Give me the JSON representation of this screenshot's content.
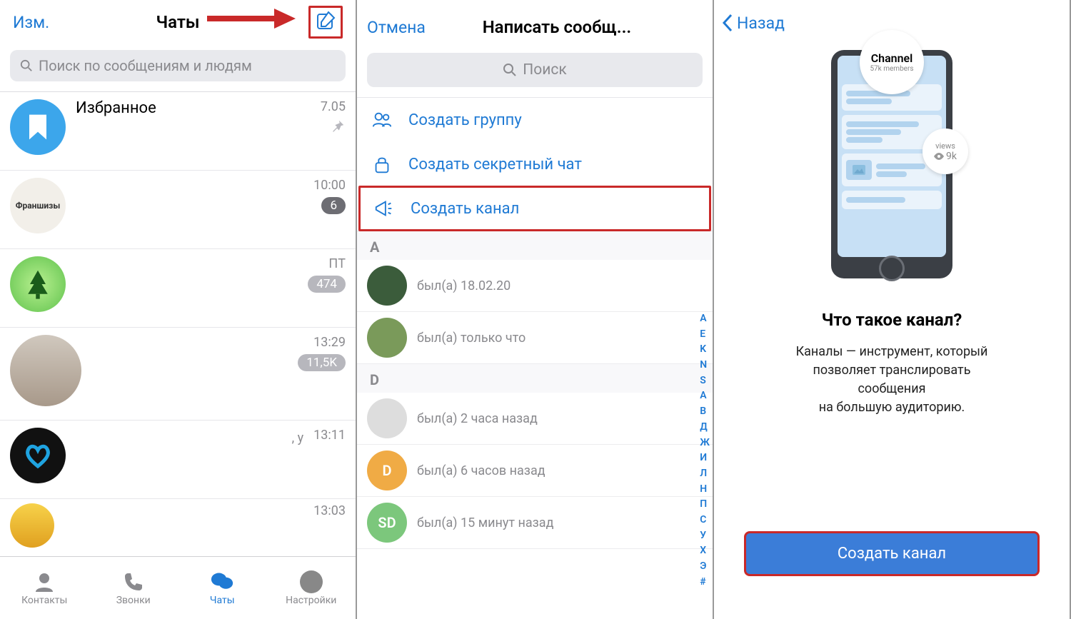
{
  "screen1": {
    "edit": "Изм.",
    "title": "Чаты",
    "search_placeholder": "Поиск по сообщениям и людям",
    "chats": [
      {
        "title": "Избранное",
        "time": "7.05",
        "pinned": true
      },
      {
        "title": "",
        "avatar_label": "Франшизы",
        "time": "10:00",
        "badge": "6"
      },
      {
        "title": "",
        "time": "ПТ",
        "badge": "474"
      },
      {
        "title": "",
        "time": "13:29",
        "badge": "11,5K"
      },
      {
        "title": "",
        "time": "13:11",
        "sub": ", у"
      },
      {
        "title": "",
        "time": "13:03"
      }
    ],
    "tabs": [
      "Контакты",
      "Звонки",
      "Чаты",
      "Настройки"
    ]
  },
  "screen2": {
    "cancel": "Отмена",
    "title": "Написать сообщ...",
    "search_placeholder": "Поиск",
    "create": {
      "group": "Создать группу",
      "secret": "Создать секретный чат",
      "channel": "Создать канал"
    },
    "sections": [
      {
        "letter": "A",
        "contacts": [
          {
            "status": "был(а) 18.02.20"
          },
          {
            "status": "был(а) только что"
          }
        ]
      },
      {
        "letter": "D",
        "contacts": [
          {
            "status": "был(а) 2 часа назад"
          },
          {
            "status": "был(а) 6 часов назад",
            "initials": "D"
          },
          {
            "status": "был(а) 15 минут назад",
            "initials": "SD"
          }
        ]
      }
    ],
    "index": [
      "A",
      "E",
      "K",
      "N",
      "S",
      "А",
      "В",
      "Д",
      "Ж",
      "И",
      "Л",
      "Н",
      "П",
      "С",
      "У",
      "Х",
      "Э",
      "#"
    ]
  },
  "screen3": {
    "back": "Назад",
    "illus": {
      "channel": "Channel",
      "members": "57k members",
      "views_label": "views",
      "views_count": "9k"
    },
    "heading": "Что такое канал?",
    "desc_line1": "Каналы — инструмент, который",
    "desc_line2": "позволяет транслировать",
    "desc_line3": "сообщения",
    "desc_line4": "на большую аудиторию.",
    "button": "Создать канал"
  }
}
